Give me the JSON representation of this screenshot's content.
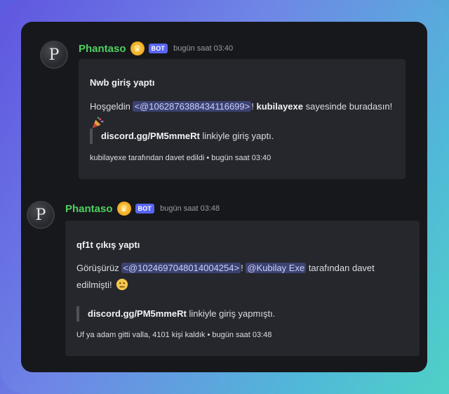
{
  "messages": [
    {
      "avatar_letter": "P",
      "username": "Phantaso",
      "bot_badge": "BOT",
      "timestamp": "bugün saat 03:40",
      "embed": {
        "title": "Nwb giriş yaptı",
        "greeting": "Hoşgeldin",
        "mention": "<@1062876388434116699>",
        "sep": "!",
        "inviter": "kubilayexe",
        "rest": "sayesinde buradasın!",
        "emoji": "party-popper-icon",
        "quote_link": "discord.gg/PM5mmeRt",
        "quote_text": "linkiyle giriş yaptı.",
        "footer": "kubilayexe tarafından davet edildi • bugün saat 03:40"
      }
    },
    {
      "avatar_letter": "P",
      "username": "Phantaso",
      "bot_badge": "BOT",
      "timestamp": "bugün saat 03:48",
      "embed": {
        "title": "qf1t çıkış yaptı",
        "greeting": "Görüşürüz",
        "mention": "<@1024697048014004254>",
        "sep": "!",
        "inviter_mention": "@Kubilay Exe",
        "rest_line1": "tarafından davet",
        "rest_line2": "edilmişti!",
        "emoji": "neutral-face-icon",
        "quote_link": "discord.gg/PM5mmeRt",
        "quote_text": "linkiyle giriş yapmıştı.",
        "footer": "Uf ya adam gitti valla, 4101 kişi kaldık • bugün saat 03:48"
      }
    }
  ],
  "colors": {
    "username": "#4ed05f",
    "bot_badge": "#5865f2",
    "window_bg": "#17181c",
    "embed_bg": "#26272d",
    "mention_bg": "#3c4270"
  }
}
